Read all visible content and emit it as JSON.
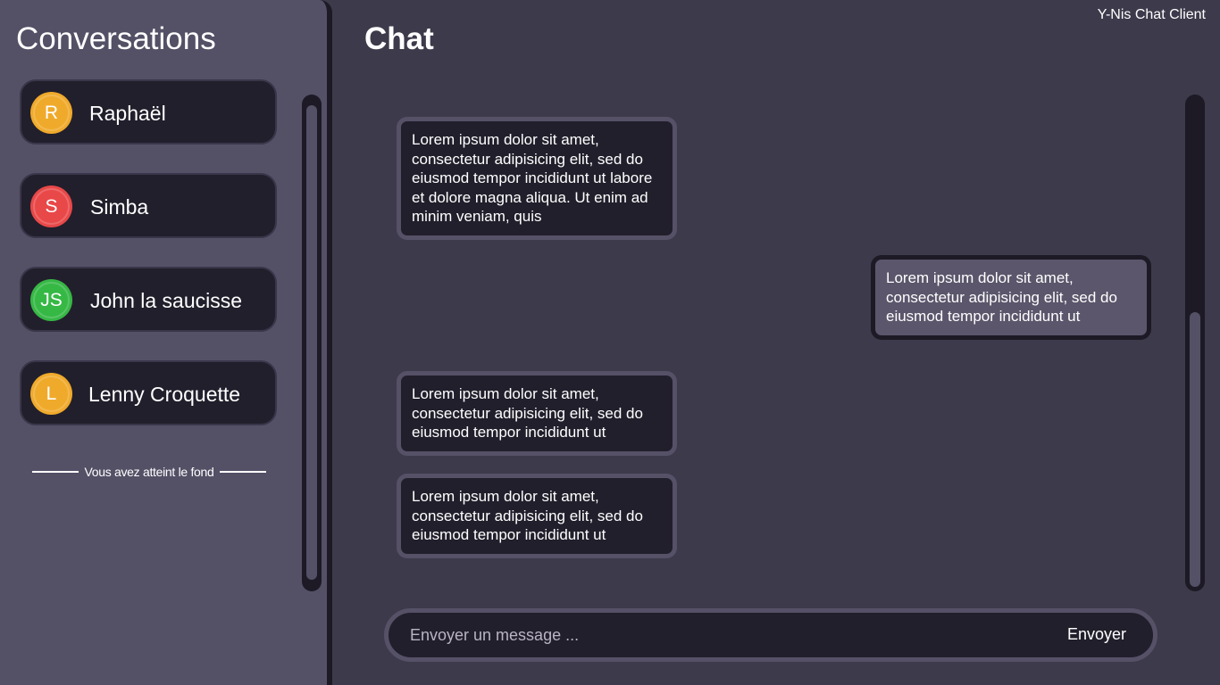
{
  "app": {
    "title": "Y-Nis Chat Client"
  },
  "sidebar": {
    "title": "Conversations",
    "items": [
      {
        "initials": "R",
        "name": "Raphaël",
        "color": "#f0aa2b"
      },
      {
        "initials": "S",
        "name": "Simba",
        "color": "#e94848"
      },
      {
        "initials": "JS",
        "name": "John la saucisse",
        "color": "#36b845"
      },
      {
        "initials": "L",
        "name": "Lenny Croquette",
        "color": "#f0aa2b"
      }
    ],
    "end_note": "Vous avez atteint le fond"
  },
  "chat": {
    "title": "Chat",
    "messages": [
      {
        "direction": "in",
        "text": "Lorem ipsum dolor sit amet, consectetur adipisicing elit, sed do eiusmod tempor incididunt ut labore et dolore magna aliqua. Ut enim ad minim veniam, quis"
      },
      {
        "direction": "out",
        "text": "Lorem ipsum dolor sit amet, consectetur adipisicing elit, sed do eiusmod tempor incididunt ut"
      },
      {
        "direction": "in",
        "text": "Lorem ipsum dolor sit amet, consectetur adipisicing elit, sed do eiusmod tempor incididunt ut"
      },
      {
        "direction": "in",
        "text": "Lorem ipsum dolor sit amet, consectetur adipisicing elit, sed do eiusmod tempor incididunt ut"
      }
    ]
  },
  "composer": {
    "placeholder": "Envoyer un message ...",
    "value": "",
    "send_label": "Envoyer"
  },
  "colors": {
    "background": "#3d3a4b",
    "sidebar": "#545066",
    "card": "#221f2c",
    "outgoing_bubble": "#5b566b"
  }
}
